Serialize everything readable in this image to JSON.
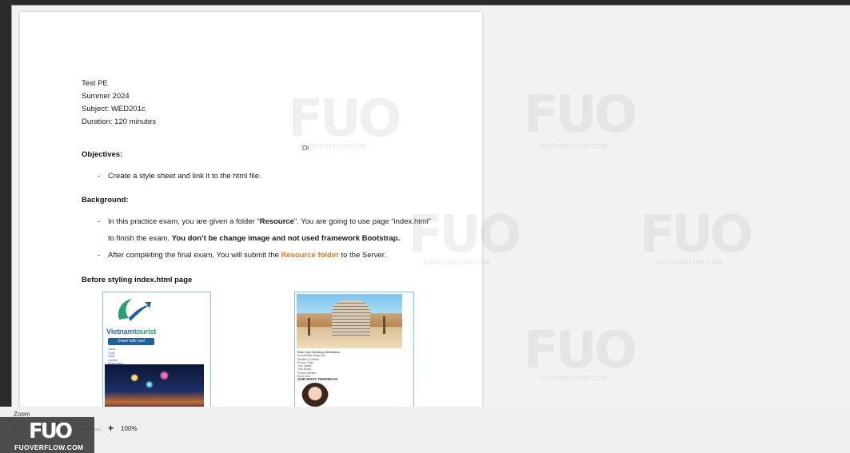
{
  "document": {
    "header_lines": [
      "Test PE",
      "Summer 2024",
      "Subject: WED201c",
      "Duration: 120 minutes"
    ],
    "stray_mark": "Ol",
    "objectives": {
      "title": "Objectives:",
      "bullets": [
        "Create a style sheet and link it to the html file."
      ]
    },
    "background": {
      "title": "Background:",
      "bullet1_line1_a": "In this practice exam, you are given a folder “",
      "bullet1_line1_bold": "Resource",
      "bullet1_line1_b": "”. You are going to use page “index.html”",
      "bullet1_line2_a": "to finish the exam. ",
      "bullet1_line2_bold": "You don’t be change image and not used framework Bootstrap.",
      "bullet2_a": "After completing the final exam, You will submit the ",
      "bullet2_highlight": "Resource folder",
      "bullet2_b": " to the Server."
    },
    "before_styling_title": "Before styling index.html page",
    "dash": "-"
  },
  "screenshot_left": {
    "brand_a": "Vietnam",
    "brand_b": "tourist",
    "tagline": "Travel with you!",
    "nav_items": [
      "Home",
      "Tours",
      "Hotel",
      "Contact",
      "Reservation"
    ]
  },
  "screenshot_right": {
    "form_lines": [
      "Enter Your Booking Information",
      "Arrival Date  Departure",
      "Number of Adults",
      "Rooms Type",
      "Your Name",
      "Your Email",
      "Phone Number",
      "Book Now"
    ],
    "feedback_title": "OUR MOST FEEDBACK"
  },
  "zoom": {
    "label": "Zoom",
    "minus": "-",
    "plus": "+",
    "value": "100%",
    "level_percent": 100
  },
  "watermark": {
    "logo": "FUO",
    "site": "FUOVERFLOW.COM"
  },
  "colors": {
    "accent_orange": "#e27a20",
    "thumb_blue": "#4a8ad0",
    "shot_border": "#7fc7e0"
  }
}
